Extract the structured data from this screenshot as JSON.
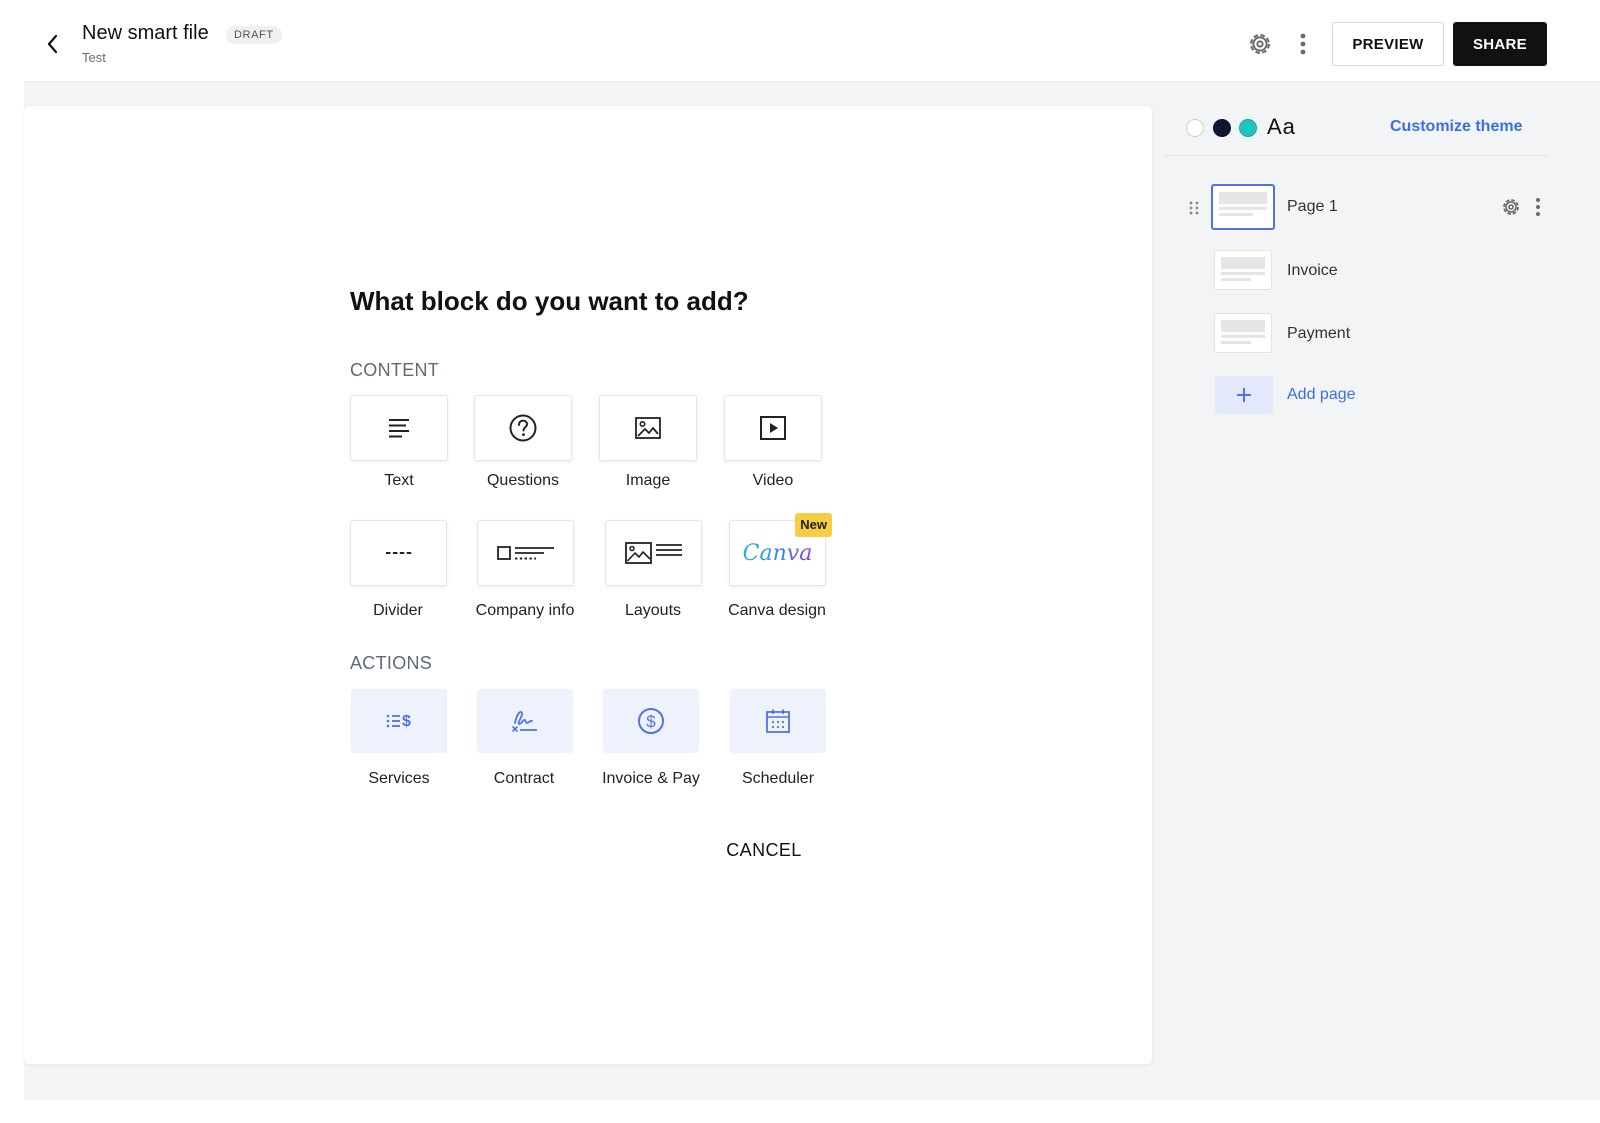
{
  "header": {
    "title": "New smart file",
    "badge": "DRAFT",
    "subtitle": "Test",
    "preview_label": "PREVIEW",
    "share_label": "SHARE"
  },
  "modal": {
    "title": "What block do you want to add?",
    "content_label": "CONTENT",
    "content_items": [
      {
        "label": "Text",
        "icon": "text-lines-icon"
      },
      {
        "label": "Questions",
        "icon": "question-circle-icon"
      },
      {
        "label": "Image",
        "icon": "image-icon"
      },
      {
        "label": "Video",
        "icon": "video-play-icon"
      },
      {
        "label": "Divider",
        "icon": "divider-icon"
      },
      {
        "label": "Company info",
        "icon": "company-info-icon"
      },
      {
        "label": "Layouts",
        "icon": "layouts-icon"
      },
      {
        "label": "Canva design",
        "icon": "canva-logo",
        "logo_text": "Canva",
        "badge": "New"
      }
    ],
    "actions_label": "ACTIONS",
    "action_items": [
      {
        "label": "Services",
        "icon": "services-icon"
      },
      {
        "label": "Contract",
        "icon": "signature-icon"
      },
      {
        "label": "Invoice & Pay",
        "icon": "dollar-circle-icon"
      },
      {
        "label": "Scheduler",
        "icon": "calendar-icon"
      }
    ],
    "cancel_label": "CANCEL"
  },
  "sidebar": {
    "theme": {
      "swatches": [
        "#ffffff",
        "#0f1530",
        "#1ec3c3"
      ],
      "font_sample": "Aa",
      "customize_label": "Customize theme"
    },
    "pages": [
      {
        "label": "Page 1",
        "active": true
      },
      {
        "label": "Invoice",
        "active": false
      },
      {
        "label": "Payment",
        "active": false
      }
    ],
    "add_page_label": "Add page"
  },
  "colors": {
    "accent": "#3b6fe0",
    "badge_new": "#f7cd45",
    "action_tile_bg": "#eef2fd"
  }
}
